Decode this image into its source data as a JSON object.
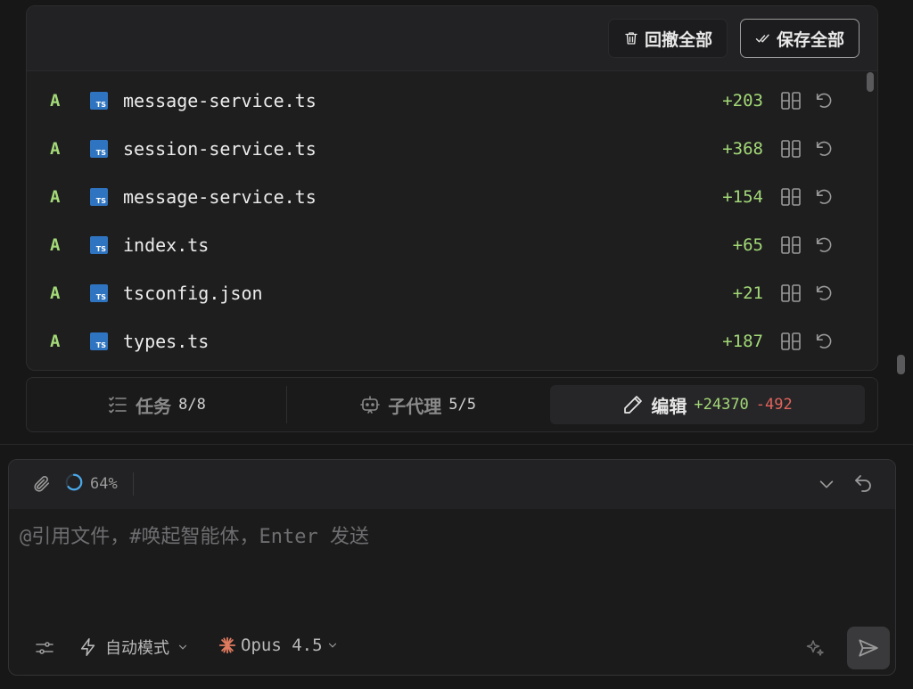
{
  "files_toolbar": {
    "revert_all_label": "回撤全部",
    "save_all_label": "保存全部"
  },
  "files": [
    {
      "status": "A",
      "icon_text": "TS",
      "name": "message-service.ts",
      "added": "+203"
    },
    {
      "status": "A",
      "icon_text": "TS",
      "name": "session-service.ts",
      "added": "+368"
    },
    {
      "status": "A",
      "icon_text": "TS",
      "name": "message-service.ts",
      "added": "+154"
    },
    {
      "status": "A",
      "icon_text": "TS",
      "name": "index.ts",
      "added": "+65"
    },
    {
      "status": "A",
      "icon_text": "TS",
      "name": "tsconfig.json",
      "added": "+21"
    },
    {
      "status": "A",
      "icon_text": "TS",
      "name": "types.ts",
      "added": "+187"
    }
  ],
  "tabs": {
    "tasks": {
      "label": "任务",
      "count": "8/8"
    },
    "agents": {
      "label": "子代理",
      "count": "5/5"
    },
    "edit": {
      "label": "编辑",
      "added": "+24370",
      "removed": "-492"
    }
  },
  "composer": {
    "progress": "64%",
    "progress_fraction": 0.64,
    "placeholder": "@引用文件，#唤起智能体，Enter 发送",
    "mode_label": "自动模式",
    "model_label": "Opus 4.5"
  },
  "colors": {
    "added": "#a3d977",
    "removed": "#e0645c",
    "ts_icon": "#2f74c0",
    "model_star": "#e07a5f",
    "progress": "#4aa8e8"
  },
  "icons": {
    "revert_all": "trash-icon",
    "save_all": "double-check-icon",
    "row_diff": "split-view-icon",
    "row_revert": "undo-icon",
    "tasks": "checklist-icon",
    "agents": "agent-icon",
    "edit": "pencil-icon",
    "attach": "paperclip-icon",
    "collapse": "chevron-down-icon",
    "reset": "undo-icon",
    "settings": "sliders-icon",
    "mode": "lightning-icon",
    "model": "asterisk-star-icon",
    "enhance": "sparkle-icon",
    "send": "send-icon"
  }
}
